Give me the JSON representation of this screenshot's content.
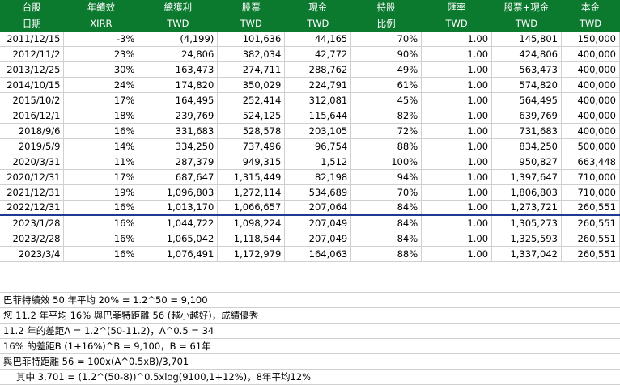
{
  "header": {
    "row1": [
      "台股",
      "年績效",
      "總獲利",
      "股票",
      "現金",
      "持股",
      "匯率",
      "股票+現金",
      "本金"
    ],
    "row2": [
      "日期",
      "XIRR",
      "TWD",
      "TWD",
      "TWD",
      "比例",
      "TWD",
      "TWD",
      "TWD"
    ]
  },
  "rows": [
    [
      "2011/12/15",
      "-3%",
      "(4,199)",
      "101,636",
      "44,165",
      "70%",
      "1.00",
      "145,801",
      "150,000"
    ],
    [
      "2012/11/2",
      "23%",
      "24,806",
      "382,034",
      "42,772",
      "90%",
      "1.00",
      "424,806",
      "400,000"
    ],
    [
      "2013/12/25",
      "30%",
      "163,473",
      "274,711",
      "288,762",
      "49%",
      "1.00",
      "563,473",
      "400,000"
    ],
    [
      "2014/10/15",
      "24%",
      "174,820",
      "350,029",
      "224,791",
      "61%",
      "1.00",
      "574,820",
      "400,000"
    ],
    [
      "2015/10/2",
      "17%",
      "164,495",
      "252,414",
      "312,081",
      "45%",
      "1.00",
      "564,495",
      "400,000"
    ],
    [
      "2016/12/1",
      "18%",
      "239,769",
      "524,125",
      "115,644",
      "82%",
      "1.00",
      "639,769",
      "400,000"
    ],
    [
      "2018/9/6",
      "16%",
      "331,683",
      "528,578",
      "203,105",
      "72%",
      "1.00",
      "731,683",
      "400,000"
    ],
    [
      "2019/5/9",
      "14%",
      "334,250",
      "737,496",
      "96,754",
      "88%",
      "1.00",
      "834,250",
      "500,000"
    ],
    [
      "2020/3/31",
      "11%",
      "287,379",
      "949,315",
      "1,512",
      "100%",
      "1.00",
      "950,827",
      "663,448"
    ],
    [
      "2020/12/31",
      "17%",
      "687,647",
      "1,315,449",
      "82,198",
      "94%",
      "1.00",
      "1,397,647",
      "710,000"
    ],
    [
      "2021/12/31",
      "19%",
      "1,096,803",
      "1,272,114",
      "534,689",
      "70%",
      "1.00",
      "1,806,803",
      "710,000"
    ],
    [
      "2022/12/31",
      "16%",
      "1,013,170",
      "1,066,657",
      "207,064",
      "84%",
      "1.00",
      "1,273,721",
      "260,551"
    ],
    [
      "2023/1/28",
      "16%",
      "1,044,722",
      "1,098,224",
      "207,049",
      "84%",
      "1.00",
      "1,305,273",
      "260,551"
    ],
    [
      "2023/2/28",
      "16%",
      "1,065,042",
      "1,118,544",
      "207,049",
      "84%",
      "1.00",
      "1,325,593",
      "260,551"
    ],
    [
      "2023/3/4",
      "16%",
      "1,076,491",
      "1,172,979",
      "164,063",
      "88%",
      "1.00",
      "1,337,042",
      "260,551"
    ]
  ],
  "notes": [
    "巴菲特績效 50 年平均 20% = 1.2^50 = 9,100",
    "您 11.2 年平均 16% 與巴菲特距離 56 (越小越好)，成績優秀",
    "11.2 年的差距A = 1.2^(50-11.2)，A^0.5 = 34",
    "16% 的差距B (1+16%)^B = 9,100，B = 61年",
    "與巴菲特距離 56 = 100x(A^0.5xB)/3,701",
    "其中 3,701 = (1.2^(50-8))^0.5xlog(9100,1+12%)，8年平均12%"
  ]
}
